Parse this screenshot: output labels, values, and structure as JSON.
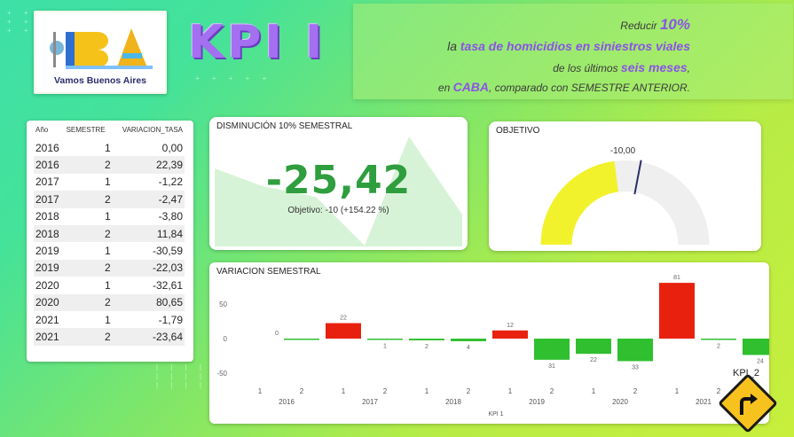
{
  "logo": {
    "text": "Vamos Buenos Aires",
    "mark": "BA"
  },
  "header": {
    "kpi_title": "KPI I"
  },
  "banner": {
    "line1_pre": "Reducir ",
    "line1_hl": "10%",
    "line2_pre": "la ",
    "line2_hl": "tasa de homicidios en siniestros viales",
    "line3_pre": "de los últimos ",
    "line3_hl": "seis meses",
    "line3_post": ",",
    "line4_pre": "en ",
    "line4_hl": "CABA",
    "line4_post": ", comparado con SEMESTRE ANTERIOR."
  },
  "table": {
    "headers": [
      "Año",
      "SEMESTRE",
      "VARIACION_TASA"
    ],
    "rows": [
      [
        "2016",
        "1",
        "0,00"
      ],
      [
        "2016",
        "2",
        "22,39"
      ],
      [
        "2017",
        "1",
        "-1,22"
      ],
      [
        "2017",
        "2",
        "-2,47"
      ],
      [
        "2018",
        "1",
        "-3,80"
      ],
      [
        "2018",
        "2",
        "11,84"
      ],
      [
        "2019",
        "1",
        "-30,59"
      ],
      [
        "2019",
        "2",
        "-22,03"
      ],
      [
        "2020",
        "1",
        "-32,61"
      ],
      [
        "2020",
        "2",
        "80,65"
      ],
      [
        "2021",
        "1",
        "-1,79"
      ],
      [
        "2021",
        "2",
        "-23,64"
      ]
    ]
  },
  "disminucion": {
    "title": "DISMINUCIÓN 10% SEMESTRAL",
    "value": "-25,42",
    "subtitle": "Objetivo: -10 (+154.22 %)"
  },
  "objetivo": {
    "title": "OBJETIVO",
    "target_label": "-10,00",
    "gauge_fill": 0.46,
    "target_fraction": 0.56
  },
  "variacion": {
    "title": "VARIACION SEMESTRAL",
    "xaxis_title": "KPI 1",
    "corner_label": "KPI_2"
  },
  "chart_data": {
    "type": "bar",
    "title": "VARIACION SEMESTRAL",
    "xlabel": "KPI 1",
    "ylim": [
      -60,
      85
    ],
    "yticks": [
      50,
      0,
      -50
    ],
    "categories": [
      "2016 1",
      "2016 2",
      "2017 1",
      "2017 2",
      "2018 1",
      "2018 2",
      "2019 1",
      "2019 2",
      "2020 1",
      "2020 2",
      "2021 1",
      "2021 2"
    ],
    "semester_labels": [
      "1",
      "2",
      "1",
      "2",
      "1",
      "2",
      "1",
      "2",
      "1",
      "2",
      "1",
      "2"
    ],
    "year_labels": [
      "2016",
      "2017",
      "2018",
      "2019",
      "2020",
      "2021"
    ],
    "values": [
      0,
      22.39,
      -1.22,
      -2.47,
      -3.8,
      11.84,
      -30.59,
      -22.03,
      -32.61,
      80.65,
      -1.79,
      -23.64
    ],
    "data_labels": [
      "0",
      "22",
      "1",
      "2",
      "4",
      "12",
      "31",
      "22",
      "33",
      "81",
      "2",
      "24"
    ],
    "colors": {
      "increase": "#e8210f",
      "decrease": "#2fbf2f"
    }
  }
}
